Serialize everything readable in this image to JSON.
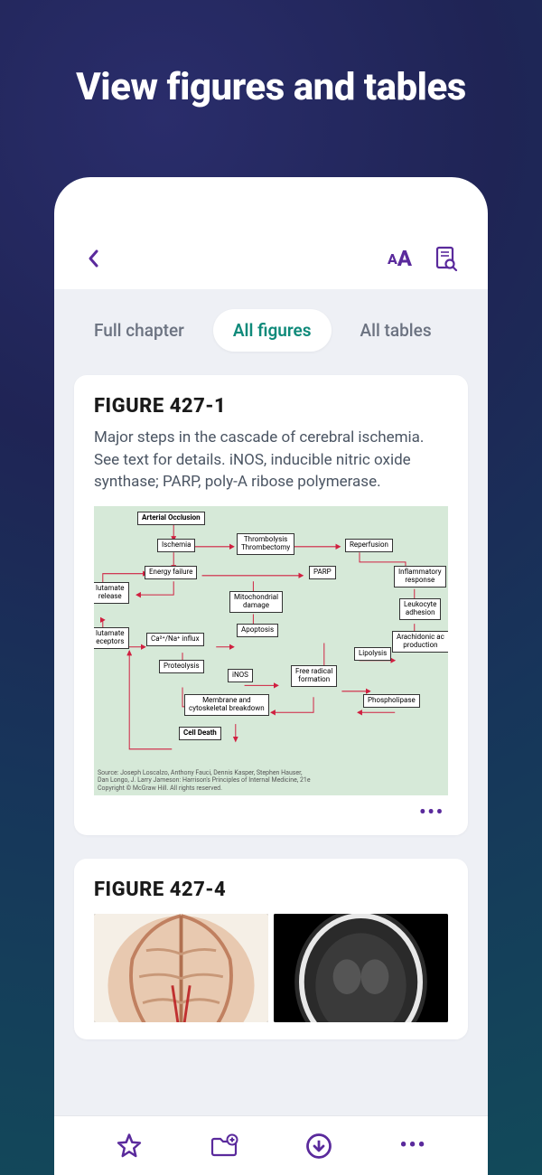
{
  "hero": {
    "title": "View figures and tables"
  },
  "tabs": {
    "items": [
      {
        "label": "Full chapter"
      },
      {
        "label": "All figures"
      },
      {
        "label": "All tables"
      }
    ],
    "active_index": 1
  },
  "figure1": {
    "title": "FIGURE 427-1",
    "caption": "Major steps in the cascade of cerebral ischemia. See text for details. iNOS, inducible nitric oxide synthase; PARP, poly-A ribose polymerase.",
    "diagram": {
      "nodes": {
        "arterial_occlusion": "Arterial Occlusion",
        "ischemia": "Ischemia",
        "thrombolysis": "Thrombolysis\nThrombectomy",
        "reperfusion": "Reperfusion",
        "energy_failure": "Energy failure",
        "parp": "PARP",
        "inflammatory": "Inflammatory\nresponse",
        "glutamate_release": "lutamate\nrelease",
        "mito_damage": "Mitochondrial\ndamage",
        "leukocyte": "Leukocyte\nadhesion",
        "glutamate_receptors": "lutamate\neceptors",
        "ca_na_influx": "Ca²⁺/Na⁺ influx",
        "apoptosis": "Apoptosis",
        "arachidonic": "Arachidonic ac\nproduction",
        "proteolysis": "Proteolysis",
        "inos": "iNOS",
        "free_radical": "Free radical\nformation",
        "lipolysis": "Lipolysis",
        "membrane": "Membrane and\ncytoskeletal breakdown",
        "phospholipase": "Phospholipase",
        "cell_death": "Cell Death"
      },
      "source": "Source: Joseph Loscalzo, Anthony Fauci, Dennis Kasper, Stephen Hauser,\nDan Longo, J. Larry Jameson: Harrison's Principles of Internal Medicine, 21e\nCopyright © McGraw Hill. All rights reserved."
    }
  },
  "figure2": {
    "title": "FIGURE 427-4"
  },
  "more_dots": "•••"
}
